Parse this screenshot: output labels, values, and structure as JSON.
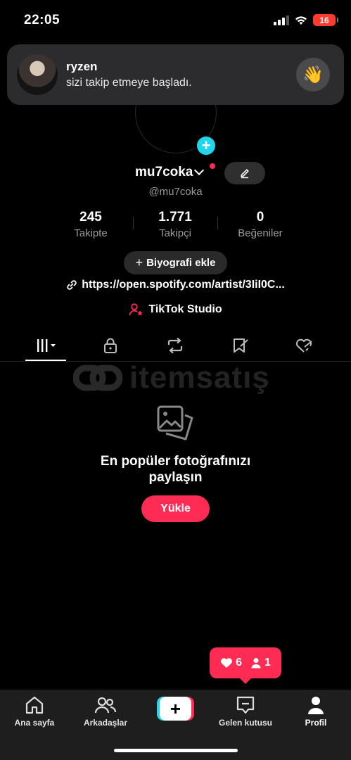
{
  "status_bar": {
    "time": "22:05",
    "battery": "16"
  },
  "notification": {
    "name": "ryzen",
    "message": "sizi takip etmeye başladı.",
    "action_icon": "wave-hand-icon"
  },
  "profile": {
    "username": "mu7coka",
    "handle": "@mu7coka",
    "stats": [
      {
        "value": "245",
        "label": "Takipte"
      },
      {
        "value": "1.771",
        "label": "Takipçi"
      },
      {
        "value": "0",
        "label": "Beğeniler"
      }
    ],
    "bio_button": "Biyografi ekle",
    "link": "https://open.spotify.com/artist/3IiI0C...",
    "studio": "TikTok Studio"
  },
  "tabs": [
    "videos-grid-icon",
    "lock-icon",
    "repost-icon",
    "saved-icon",
    "liked-icon"
  ],
  "watermark": "itemsatış",
  "empty_state": {
    "title_line1": "En popüler fotoğrafınızı",
    "title_line2": "paylaşın",
    "upload_button": "Yükle"
  },
  "activity_bubble": {
    "likes": "6",
    "followers": "1"
  },
  "bottom_nav": {
    "home": "Ana sayfa",
    "friends": "Arkadaşlar",
    "inbox": "Gelen kutusu",
    "profile": "Profil"
  },
  "colors": {
    "accent": "#fe2c55",
    "cyan": "#20d5ec",
    "background": "#000000"
  }
}
